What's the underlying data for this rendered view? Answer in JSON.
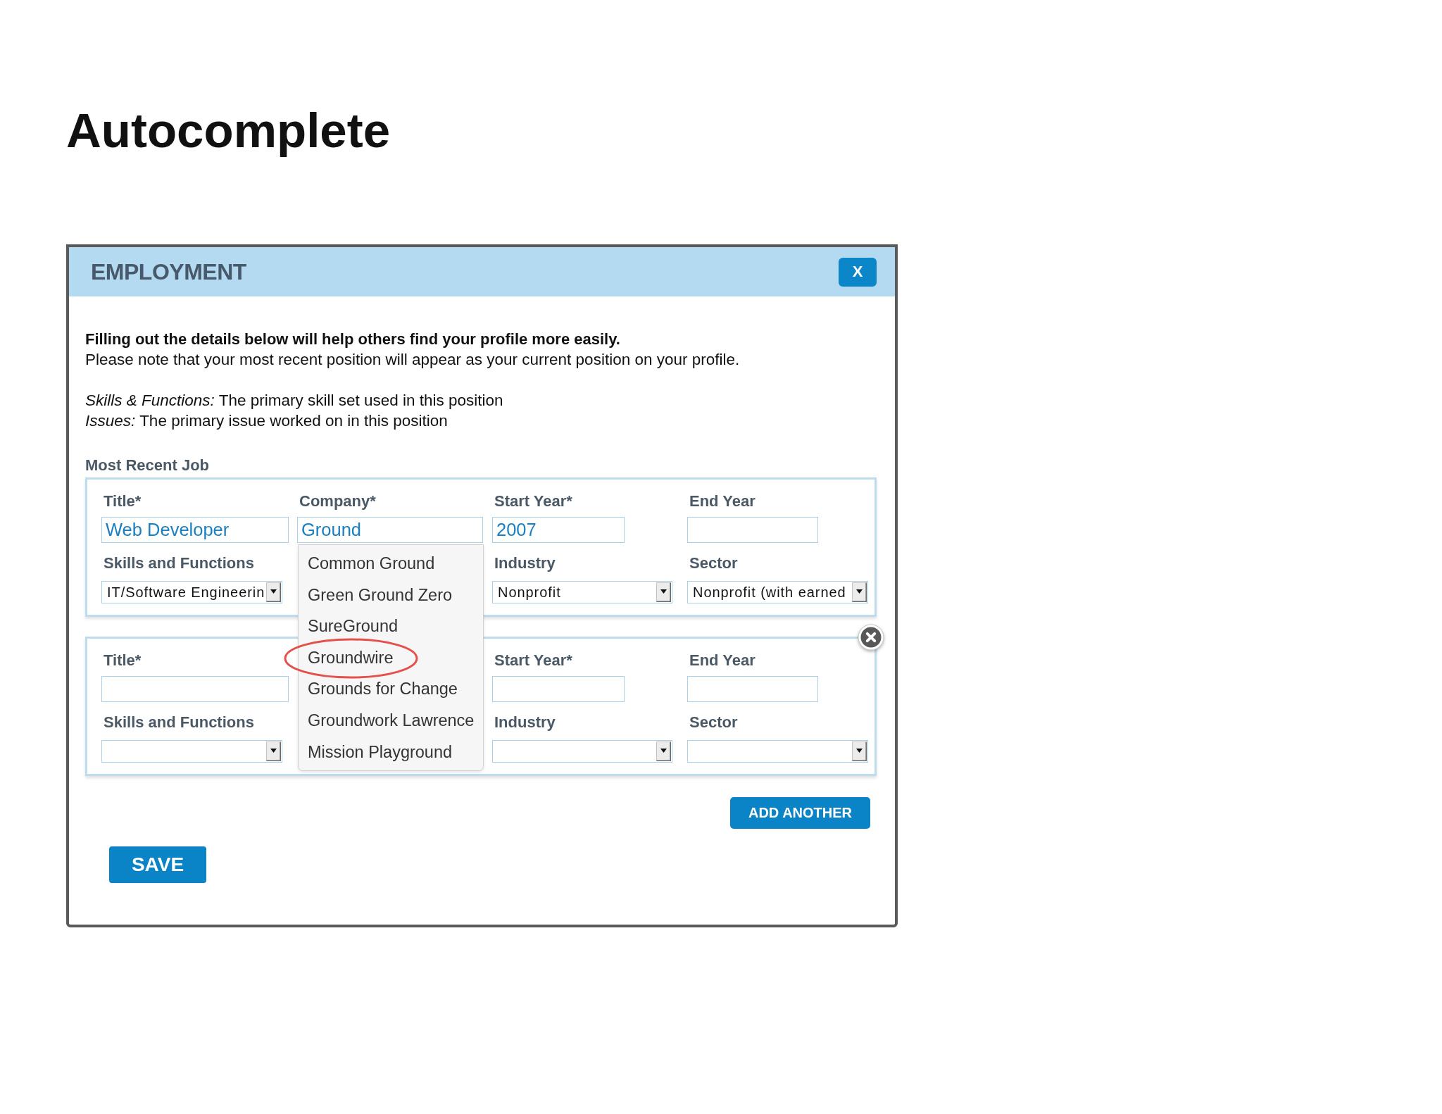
{
  "page_title": "Autocomplete",
  "dialog": {
    "title": "EMPLOYMENT",
    "close_button": "X",
    "intro": {
      "lead": "Filling out the details below will help others find your profile more easily.",
      "note": "Please note that your most recent position will appear as your current position on your profile."
    },
    "definitions": [
      "*Skills & Functions:* The primary skill set used in this position",
      "*Issues:* The primary issue worked on in this position"
    ],
    "section_label": "Most Recent Job",
    "jobs": [
      {
        "removable": false,
        "rows": [
          [
            {
              "kind": "text",
              "label": "Title*",
              "value": "Web Developer"
            },
            {
              "kind": "text",
              "label": "Company*",
              "value": "Ground",
              "suggestions": [
                {
                  "text": "Common Ground",
                  "circled": false
                },
                {
                  "text": "Green Ground Zero",
                  "circled": false
                },
                {
                  "text": "SureGround",
                  "circled": false
                },
                {
                  "text": "Groundwire",
                  "circled": true
                },
                {
                  "text": "Grounds for Change",
                  "circled": false
                },
                {
                  "text": "Groundwork Lawrence",
                  "circled": false
                },
                {
                  "text": "Mission Playground",
                  "circled": false
                }
              ]
            },
            {
              "kind": "text",
              "label": "Start Year*",
              "value": "2007"
            },
            {
              "kind": "text",
              "label": "End Year"
            }
          ],
          [
            {
              "kind": "select",
              "label": "Skills and Functions",
              "value": "IT/Software Engineerin"
            },
            "",
            {
              "kind": "select",
              "label": "Industry",
              "value": "Nonprofit"
            },
            {
              "kind": "select",
              "label": "Sector",
              "value": "Nonprofit (with earned"
            }
          ]
        ]
      },
      {
        "removable": true,
        "rows": [
          [
            {
              "kind": "text",
              "label": "Title*"
            },
            "",
            {
              "kind": "text",
              "label": "Start Year*"
            },
            {
              "kind": "text",
              "label": "End Year"
            }
          ],
          [
            {
              "kind": "select",
              "label": "Skills and Functions"
            },
            "",
            {
              "kind": "select",
              "label": "Industry"
            },
            {
              "kind": "select",
              "label": "Sector"
            }
          ]
        ]
      }
    ],
    "add_button": "ADD ANOTHER",
    "save_button": "SAVE"
  }
}
